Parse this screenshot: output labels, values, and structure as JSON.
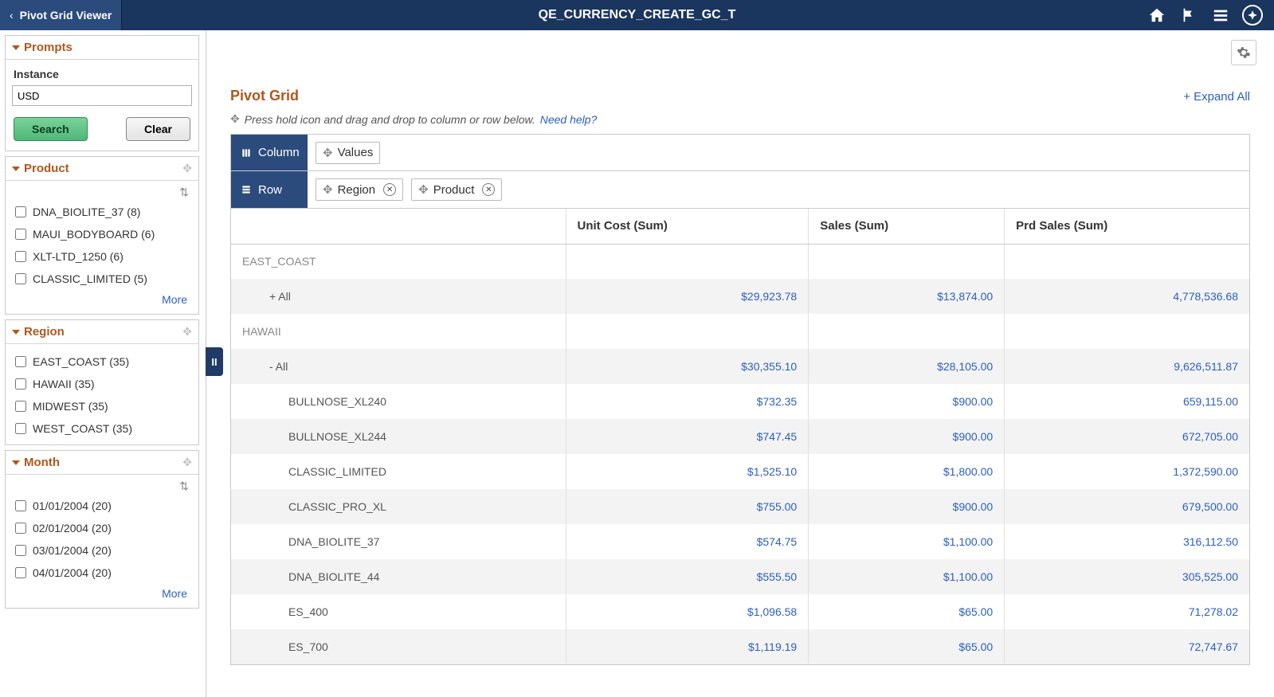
{
  "header": {
    "back_label": "Pivot Grid Viewer",
    "page_title": "QE_CURRENCY_CREATE_GC_T"
  },
  "prompts": {
    "title": "Prompts",
    "instance_label": "Instance",
    "instance_value": "USD",
    "search_label": "Search",
    "clear_label": "Clear"
  },
  "facets": {
    "product": {
      "title": "Product",
      "items": [
        "DNA_BIOLITE_37 (8)",
        "MAUI_BODYBOARD (6)",
        "XLT-LTD_1250 (6)",
        "CLASSIC_LIMITED (5)"
      ],
      "more": "More"
    },
    "region": {
      "title": "Region",
      "items": [
        "EAST_COAST (35)",
        "HAWAII (35)",
        "MIDWEST (35)",
        "WEST_COAST (35)"
      ]
    },
    "month": {
      "title": "Month",
      "items": [
        "01/01/2004 (20)",
        "02/01/2004 (20)",
        "03/01/2004 (20)",
        "04/01/2004 (20)"
      ],
      "more": "More"
    }
  },
  "pivot": {
    "title": "Pivot Grid",
    "expand_all": "+ Expand All",
    "hint": "Press hold icon and drag and drop to column or row below.",
    "need_help": "Need help?",
    "column_label": "Column",
    "row_label": "Row",
    "column_chips": [
      "Values"
    ],
    "row_chips": [
      "Region",
      "Product"
    ],
    "headers": [
      "",
      "Unit Cost (Sum)",
      "Sales (Sum)",
      "Prd Sales (Sum)"
    ],
    "rows": [
      {
        "type": "region",
        "label": "EAST_COAST"
      },
      {
        "type": "all",
        "label": "+ All",
        "values": [
          "$29,923.78",
          "$13,874.00",
          "4,778,536.68"
        ]
      },
      {
        "type": "region",
        "label": "HAWAII"
      },
      {
        "type": "all",
        "label": "- All",
        "values": [
          "$30,355.10",
          "$28,105.00",
          "9,626,511.87"
        ]
      },
      {
        "type": "product",
        "label": "BULLNOSE_XL240",
        "values": [
          "$732.35",
          "$900.00",
          "659,115.00"
        ]
      },
      {
        "type": "product",
        "label": "BULLNOSE_XL244",
        "values": [
          "$747.45",
          "$900.00",
          "672,705.00"
        ]
      },
      {
        "type": "product",
        "label": "CLASSIC_LIMITED",
        "values": [
          "$1,525.10",
          "$1,800.00",
          "1,372,590.00"
        ]
      },
      {
        "type": "product",
        "label": "CLASSIC_PRO_XL",
        "values": [
          "$755.00",
          "$900.00",
          "679,500.00"
        ]
      },
      {
        "type": "product",
        "label": "DNA_BIOLITE_37",
        "values": [
          "$574.75",
          "$1,100.00",
          "316,112.50"
        ]
      },
      {
        "type": "product",
        "label": "DNA_BIOLITE_44",
        "values": [
          "$555.50",
          "$1,100.00",
          "305,525.00"
        ]
      },
      {
        "type": "product",
        "label": "ES_400",
        "values": [
          "$1,096.58",
          "$65.00",
          "71,278.02"
        ]
      },
      {
        "type": "product",
        "label": "ES_700",
        "values": [
          "$1,119.19",
          "$65.00",
          "72,747.67"
        ]
      }
    ]
  }
}
